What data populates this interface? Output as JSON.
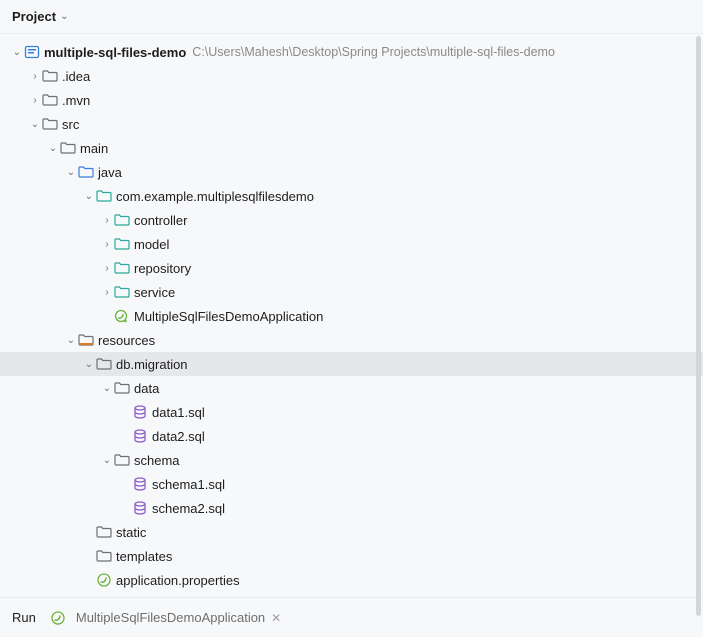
{
  "header": {
    "title": "Project"
  },
  "project": {
    "name": "multiple-sql-files-demo",
    "path": "C:\\Users\\Mahesh\\Desktop\\Spring Projects\\multiple-sql-files-demo"
  },
  "tree": {
    "idea": ".idea",
    "mvn": ".mvn",
    "src": "src",
    "main": "main",
    "java": "java",
    "pkg": "com.example.multiplesqlfilesdemo",
    "controller": "controller",
    "model": "model",
    "repository": "repository",
    "service": "service",
    "appClass": "MultipleSqlFilesDemoApplication",
    "resources": "resources",
    "dbmigration": "db.migration",
    "data": "data",
    "data1": "data1.sql",
    "data2": "data2.sql",
    "schema": "schema",
    "schema1": "schema1.sql",
    "schema2": "schema2.sql",
    "static": "static",
    "templates": "templates",
    "appProps": "application.properties"
  },
  "footer": {
    "run": "Run",
    "tab": "MultipleSqlFilesDemoApplication"
  },
  "colors": {
    "folderGray": "#6e7074",
    "folderBlue": "#3a7de0",
    "folderTeal": "#2aa79b",
    "resourceStripe": "#d97a2b",
    "sqlPurple": "#8e5fc8",
    "springGreen": "#6db33f",
    "pathGray": "#8a8a8a"
  }
}
